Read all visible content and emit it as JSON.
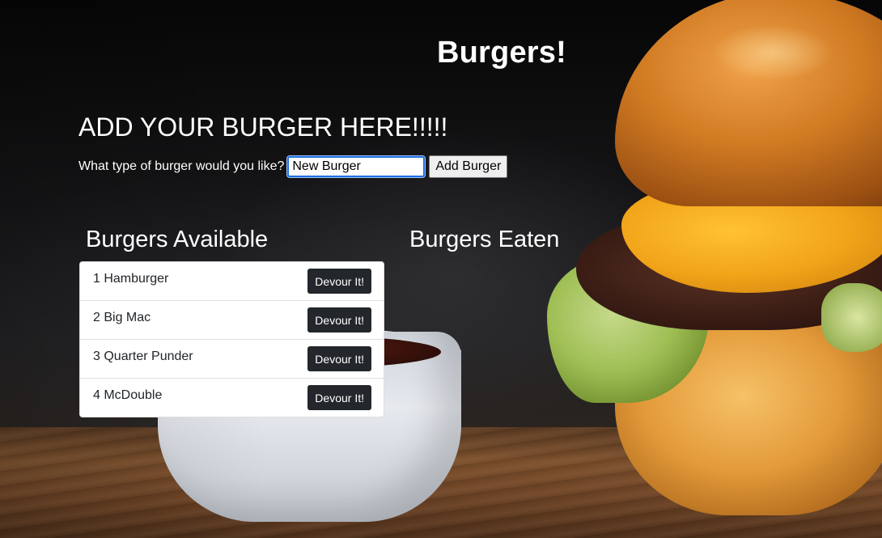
{
  "header": {
    "title": "Burgers!"
  },
  "add_form": {
    "heading": "ADD YOUR BURGER HERE!!!!!",
    "label": "What type of burger would you like?",
    "input_value": "New Burger",
    "submit_label": "Add Burger"
  },
  "available": {
    "heading": "Burgers Available",
    "items": [
      {
        "name": "1 Hamburger",
        "button_label": "Devour It!"
      },
      {
        "name": "2 Big Mac",
        "button_label": "Devour It!"
      },
      {
        "name": "3 Quarter Punder",
        "button_label": "Devour It!"
      },
      {
        "name": "4 McDouble",
        "button_label": "Devour It!"
      }
    ]
  },
  "eaten": {
    "heading": "Burgers Eaten",
    "items": []
  },
  "colors": {
    "heading_text": "#ffffff",
    "devour_button": "#23272b",
    "input_focus": "#1f6fe0"
  }
}
